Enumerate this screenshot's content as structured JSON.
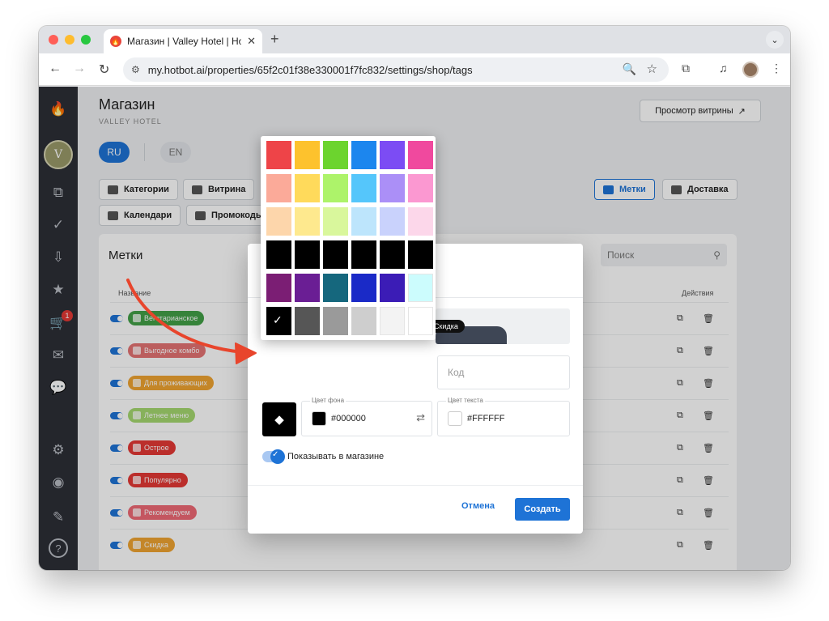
{
  "browser": {
    "tab_title": "Магазин | Valley Hotel | Hotbot",
    "url": "my.hotbot.ai/properties/65f2c01f38e330001f7fc832/settings/shop/tags",
    "close_glyph": "✕",
    "newtab_glyph": "+",
    "tabmenu_glyph": "⌄",
    "back_glyph": "←",
    "forward_glyph": "→",
    "reload_glyph": "↻",
    "tune_glyph": "⚙",
    "zoom_glyph": "🔍",
    "star_glyph": "☆",
    "extensions_glyph": "⧉",
    "media_glyph": "♫",
    "menu_glyph": "⋮"
  },
  "sidebar": {
    "icons": [
      "flame-icon",
      "chart-icon",
      "check-circle-icon",
      "inbox-icon",
      "star-inbox-icon",
      "cart-icon",
      "send-icon",
      "chat-icon",
      "settings-icon",
      "profile-icon",
      "pencil-icon",
      "help-icon"
    ],
    "glyphs": {
      "flame": "🔥",
      "chart": "⧉",
      "check": "✓",
      "inbox": "⇩",
      "stars": "★",
      "cart": "🛒",
      "send": "✉",
      "chat": "💬",
      "settings": "⚙",
      "profile": "◉",
      "pencil": "✎",
      "help": "?"
    },
    "logo": "V",
    "cart_badge": "1"
  },
  "page": {
    "title": "Магазин",
    "subtitle": "VALLEY HOTEL",
    "store_button": "Просмотр витрины",
    "store_button_glyph": "↗",
    "languages": [
      "RU",
      "EN"
    ],
    "tabs": [
      "Категории",
      "Витрина",
      "Метки",
      "Доставка",
      "Календари",
      "Промокоды"
    ]
  },
  "tags_card": {
    "title": "Метки",
    "search_placeholder": "Поиск",
    "search_glyph": "⚲",
    "col_name": "Название",
    "col_actions": "Действия",
    "copy_glyph": "⧉",
    "delete_glyph": "🗑",
    "rows": [
      {
        "label": "Вегетарианское",
        "color": "#43a047"
      },
      {
        "label": "Выгодное комбо",
        "color": "#e57373"
      },
      {
        "label": "Для проживающих",
        "color": "#f0a431"
      },
      {
        "label": "Летнее меню",
        "color": "#a5d86f"
      },
      {
        "label": "Острое",
        "color": "#e53935"
      },
      {
        "label": "Популярно",
        "color": "#e53935"
      },
      {
        "label": "Рекомендуем",
        "color": "#ef6a76"
      },
      {
        "label": "Скидка",
        "color": "#f0a431"
      }
    ]
  },
  "modal": {
    "preview_label": "Скидка",
    "code_placeholder": "Код",
    "bg_label": "Цвет фона",
    "bg_value": "#000000",
    "swap_glyph": "⇄",
    "text_label": "Цвет текста",
    "text_value": "#FFFFFF",
    "show_label": "Показывать в магазине",
    "check_glyph": "✓",
    "icon_glyph": "◆",
    "cancel": "Отмена",
    "create": "Создать"
  },
  "color_picker": {
    "selected": "#000000",
    "check_glyph": "✓",
    "rows": [
      [
        "#ee4448",
        "#fdc22d",
        "#6cd42e",
        "#1c86ee",
        "#7c4cf4",
        "#f0499e"
      ],
      [
        "#fbaa99",
        "#ffda5b",
        "#adf36a",
        "#55c6fb",
        "#ab8ff7",
        "#fb98d1"
      ],
      [
        "#fdd6ab",
        "#fee98e",
        "#d9f79c",
        "#bde5fc",
        "#c9d2fc",
        "#fcd7ea"
      ],
      [
        "#000000",
        "#000000",
        "#000000",
        "#000000",
        "#000000",
        "#000000"
      ],
      [
        "#7b1e74",
        "#6a1e94",
        "#15677d",
        "#1a2ac7",
        "#3b1cb6",
        "#ccfcfd"
      ],
      [
        "#000000",
        "#565656",
        "#9a9a9a",
        "#cecece",
        "#f3f3f3",
        "#ffffff"
      ]
    ]
  },
  "colors": {
    "accent": "#1e73d6",
    "sidebar": "#2c2f36",
    "annotation_arrow": "#e8452c"
  }
}
